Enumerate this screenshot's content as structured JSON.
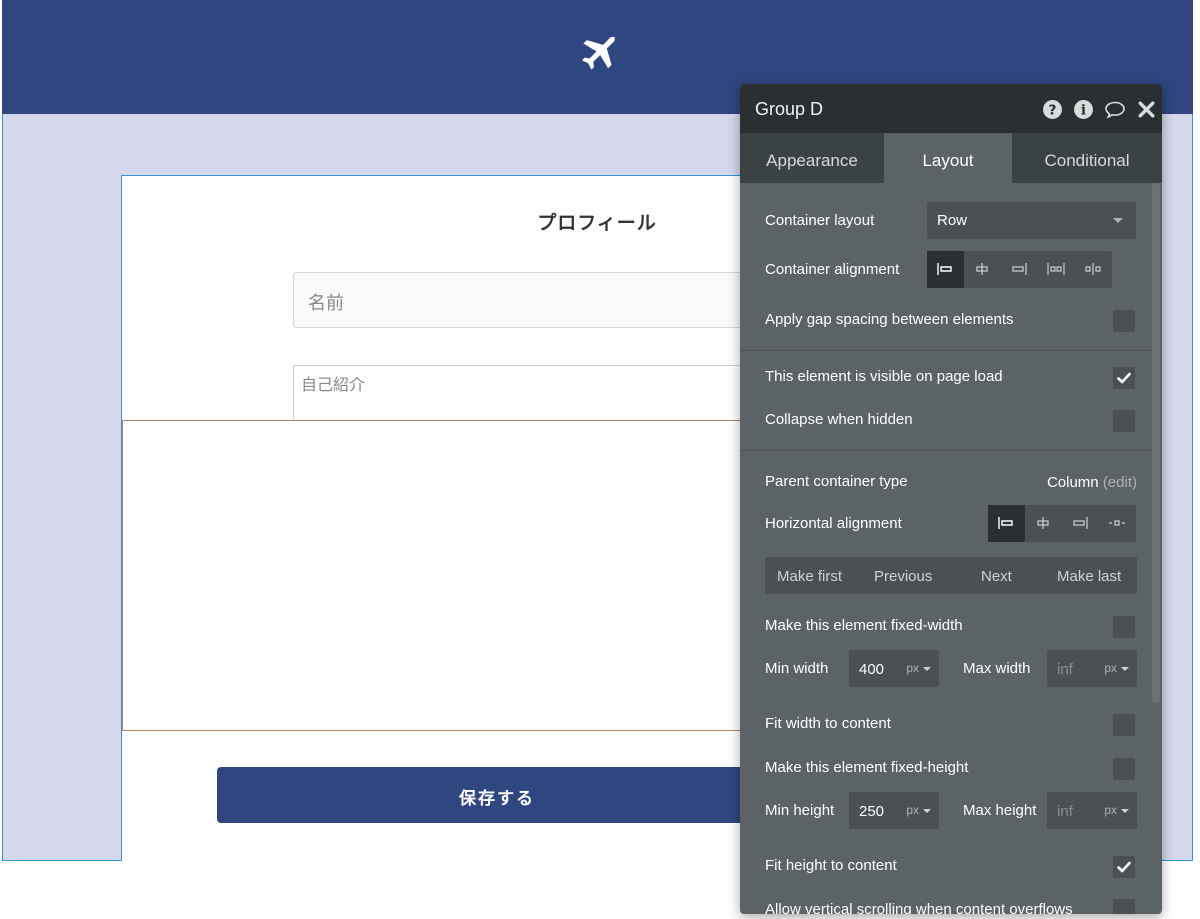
{
  "colors": {
    "brand": "#2f4680",
    "page_bg": "#d4d8ea",
    "panel_bg": "#5c6366",
    "panel_header": "#2a3032",
    "selection": "#2e97d8"
  },
  "page": {
    "header_icon": "airplane-icon",
    "title": "プロフィール",
    "name_placeholder": "名前",
    "bio_placeholder": "自己紹介",
    "save_label": "保存する"
  },
  "panel": {
    "title": "Group D",
    "header_icons": [
      "help-icon",
      "info-icon",
      "comment-icon",
      "close-icon"
    ],
    "tabs": [
      "Appearance",
      "Layout",
      "Conditional"
    ],
    "active_tab": "Layout",
    "container_layout_label": "Container layout",
    "container_layout_value": "Row",
    "container_alignment_label": "Container alignment",
    "gap_label": "Apply gap spacing between elements",
    "visible_label": "This element is visible on page load",
    "collapse_label": "Collapse when hidden",
    "parent_type_label": "Parent container type",
    "parent_type_value": "Column",
    "parent_type_edit": "(edit)",
    "h_align_label": "Horizontal alignment",
    "order_buttons": [
      "Make first",
      "Previous",
      "Next",
      "Make last"
    ],
    "fixed_width_label": "Make this element fixed-width",
    "min_width_label": "Min width",
    "min_width_value": "400",
    "min_width_unit": "px",
    "max_width_label": "Max width",
    "max_width_value": "inf",
    "max_width_unit": "px",
    "fit_width_label": "Fit width to content",
    "fixed_height_label": "Make this element fixed-height",
    "min_height_label": "Min height",
    "min_height_value": "250",
    "min_height_unit": "px",
    "max_height_label": "Max height",
    "max_height_value": "inf",
    "max_height_unit": "px",
    "fit_height_label": "Fit height to content",
    "scroll_label": "Allow vertical scrolling when content overflows",
    "checks": {
      "gap": false,
      "visible": true,
      "collapse": false,
      "fixed_width": false,
      "fit_width": false,
      "fixed_height": false,
      "fit_height": true,
      "scroll": false
    }
  }
}
